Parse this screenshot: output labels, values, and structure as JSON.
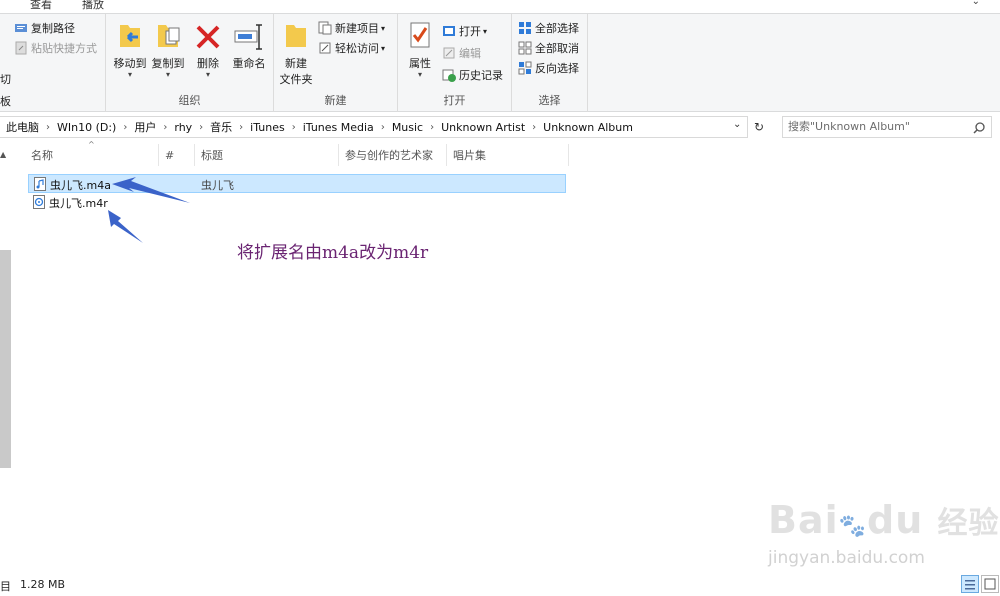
{
  "tabs": {
    "view": "查看",
    "playback": "播放"
  },
  "ribbon": {
    "clipboard": {
      "copy_path": "复制路径",
      "paste_shortcut": "粘贴快捷方式",
      "cut_partial": "切",
      "label_partial": "板"
    },
    "organize": {
      "label": "组织",
      "move_to": "移动到",
      "copy_to": "复制到",
      "delete": "删除",
      "rename": "重命名"
    },
    "new": {
      "label": "新建",
      "new_folder_line1": "新建",
      "new_folder_line2": "文件夹",
      "new_item": "新建项目",
      "easy_access": "轻松访问"
    },
    "open": {
      "label": "打开",
      "properties": "属性",
      "open": "打开",
      "edit": "编辑",
      "history": "历史记录"
    },
    "select": {
      "label": "选择",
      "select_all": "全部选择",
      "select_none": "全部取消",
      "invert": "反向选择"
    }
  },
  "address": {
    "crumbs": [
      "此电脑",
      "WIn10 (D:)",
      "用户",
      "rhy",
      "音乐",
      "iTunes",
      "iTunes Media",
      "Music",
      "Unknown Artist",
      "Unknown Album"
    ],
    "search_placeholder": "搜索\"Unknown Album\""
  },
  "columns": {
    "name": "名称",
    "num": "#",
    "title": "标题",
    "artist": "参与创作的艺术家",
    "album": "唱片集"
  },
  "files": [
    {
      "name": "虫儿飞.m4a",
      "title": "虫儿飞"
    },
    {
      "name": "虫儿飞.m4r",
      "title": ""
    }
  ],
  "annotation": "将扩展名由m4a改为m4r",
  "watermark": {
    "main": "Bai",
    "du": "du",
    "cn": "经验",
    "sub": "jingyan.baidu.com"
  },
  "status": {
    "count_partial": "目",
    "size": "1.28 MB"
  },
  "colors": {
    "selection": "#cce8ff",
    "annotation": "#6a2472",
    "arrow": "#3b63c9"
  }
}
